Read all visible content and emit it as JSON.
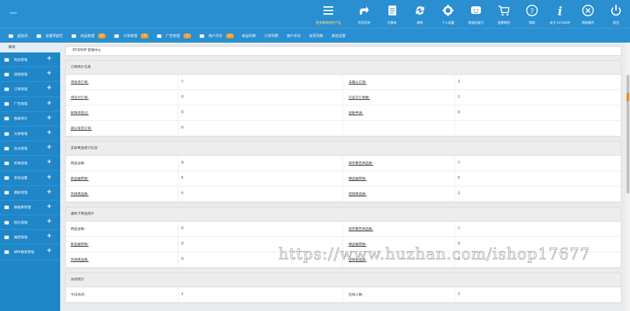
{
  "header": {
    "tools": [
      {
        "label": "更多模板插件产品",
        "icon": "menu-icon",
        "wide": true
      },
      {
        "label": "开店向导",
        "icon": "share-icon"
      },
      {
        "label": "记事本",
        "icon": "notepad-icon"
      },
      {
        "label": "刷新",
        "icon": "refresh-icon"
      },
      {
        "label": "个人设置",
        "icon": "gear-icon"
      },
      {
        "label": "管理员留言",
        "icon": "message-icon"
      },
      {
        "label": "查看网店",
        "icon": "cart-icon"
      },
      {
        "label": "帮助",
        "icon": "help-icon"
      },
      {
        "label": "关于 ECSHOP",
        "icon": "info-icon"
      },
      {
        "label": "清除缓存",
        "icon": "close-circle-icon"
      },
      {
        "label": "退出",
        "icon": "power-icon"
      }
    ]
  },
  "nav": {
    "items": [
      {
        "label": "起始页",
        "icon": "home-icon"
      },
      {
        "label": "设置导航栏",
        "icon": "monitor-icon"
      },
      {
        "label": "商品管理",
        "icon": "folder-icon",
        "badge": "0"
      },
      {
        "label": "订单管理",
        "icon": "clipboard-icon",
        "badge": "3"
      },
      {
        "label": "广告管理",
        "icon": "megaphone-icon",
        "badge": "1"
      },
      {
        "label": "用户评论",
        "icon": "users-icon",
        "badge": "1"
      },
      {
        "label": "商品列表"
      },
      {
        "label": "订单列表"
      },
      {
        "label": "用户评论"
      },
      {
        "label": "会员列表"
      },
      {
        "label": "商店设置"
      }
    ]
  },
  "sidebar": {
    "title": "菜单",
    "items": [
      {
        "label": "商品管理",
        "icon": "folder-icon"
      },
      {
        "label": "促销管理",
        "icon": "bolt-icon"
      },
      {
        "label": "订单管理",
        "icon": "clipboard-icon"
      },
      {
        "label": "广告管理",
        "icon": "megaphone-icon"
      },
      {
        "label": "报表统计",
        "icon": "pie-chart-icon"
      },
      {
        "label": "文章管理",
        "icon": "list-icon"
      },
      {
        "label": "会员管理",
        "icon": "users-icon"
      },
      {
        "label": "权限管理",
        "icon": "lock-icon"
      },
      {
        "label": "系统设置",
        "icon": "monitor-icon"
      },
      {
        "label": "模板管理",
        "icon": "template-icon"
      },
      {
        "label": "数据库管理",
        "icon": "database-icon"
      },
      {
        "label": "短信管理",
        "icon": "sms-icon"
      },
      {
        "label": "推荐管理",
        "icon": "recommend-icon"
      },
      {
        "label": "邮件群发管理",
        "icon": "mail-icon"
      }
    ]
  },
  "breadcrumb": "ECSHOP 管理中心",
  "panels": [
    {
      "title": "订单统计信息",
      "rows": [
        [
          {
            "t": "待发货订单:",
            "link": true
          },
          {
            "t": "0",
            "red": true
          },
          {
            "t": "未确认订单:",
            "link": true
          },
          {
            "t": "2"
          }
        ],
        [
          {
            "t": "待支付订单:",
            "link": true
          },
          {
            "t": "0"
          },
          {
            "t": "已成交订单数:",
            "link": true
          },
          {
            "t": "1"
          }
        ],
        [
          {
            "t": "新缺货登记:",
            "link": true
          },
          {
            "t": "0"
          },
          {
            "t": "退款申请:",
            "link": true
          },
          {
            "t": "0"
          }
        ],
        [
          {
            "t": "部分发货订单:",
            "link": true
          },
          {
            "t": "0"
          },
          {
            "t": ""
          },
          {
            "t": ""
          }
        ]
      ]
    },
    {
      "title": "实体商品统计信息",
      "rows": [
        [
          {
            "t": "商品总数:"
          },
          {
            "t": "9"
          },
          {
            "t": "库存警告商品数:",
            "link": true
          },
          {
            "t": "0",
            "red": true
          }
        ],
        [
          {
            "t": "新品推荐数:",
            "link": true
          },
          {
            "t": "5"
          },
          {
            "t": "精品推荐数:",
            "link": true
          },
          {
            "t": "5"
          }
        ],
        [
          {
            "t": "热销商品数:",
            "link": true
          },
          {
            "t": "5"
          },
          {
            "t": "促销商品数:",
            "link": true
          },
          {
            "t": "2"
          }
        ]
      ]
    },
    {
      "title": "虚拟卡商品统计",
      "rows": [
        [
          {
            "t": "商品总数:"
          },
          {
            "t": "0"
          },
          {
            "t": "库存警告商品数:",
            "link": true
          },
          {
            "t": "0",
            "red": true
          }
        ],
        [
          {
            "t": "新品推荐数:",
            "link": true
          },
          {
            "t": "0"
          },
          {
            "t": "精品推荐数:",
            "link": true
          },
          {
            "t": "0"
          }
        ],
        [
          {
            "t": "热销商品数:",
            "link": true
          },
          {
            "t": "0"
          },
          {
            "t": "促销商品数:",
            "link": true
          },
          {
            "t": "0"
          }
        ]
      ]
    },
    {
      "title": "访问统计",
      "rows": [
        [
          {
            "t": "今日访问:"
          },
          {
            "t": "1"
          },
          {
            "t": "在线人数:"
          },
          {
            "t": "2"
          }
        ]
      ]
    }
  ],
  "watermark": "https://www.huzhan.com/ishop17677",
  "colors": {
    "header": "#2a8fd1",
    "sidebar": "#1f86c8",
    "badge": "#f0a030",
    "alert": "#e0443a"
  }
}
